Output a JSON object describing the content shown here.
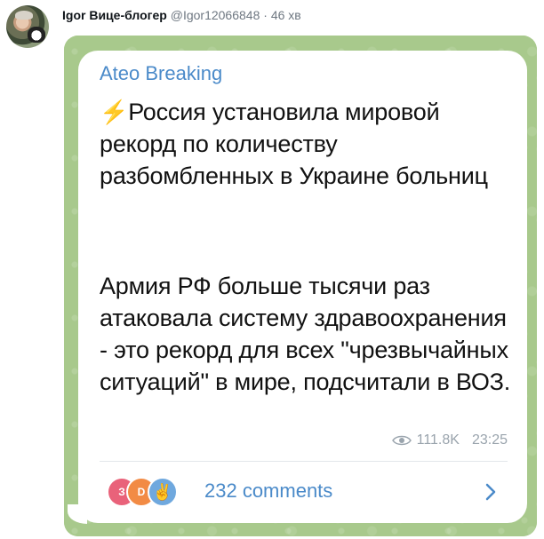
{
  "tweet": {
    "author_name": "Igor Вице-блогер",
    "author_handle": "@Igor12066848",
    "separator": "·",
    "time": "46 хв"
  },
  "telegram_post": {
    "channel_name": "Ateo Breaking",
    "headline_icon": "lightning-icon",
    "headline": "Россия установила мировой рекорд по количеству разбомбленных в Украине больниц",
    "body": "Армия РФ больше тысячи раз атаковала систему здравоохранения - это рекорд для всех \"чрезвычайных ситуаций\" в мире, подсчитали в ВОЗ.",
    "views": "111.8K",
    "post_time": "23:25",
    "comment_avatars": [
      {
        "letter": "З",
        "color": "#e9627a"
      },
      {
        "letter": "D",
        "color": "#f28b45"
      },
      {
        "letter": "✌",
        "color": "#6fa8de"
      }
    ],
    "comments_label": "232 comments"
  },
  "colors": {
    "accent_blue": "#4a8ac9",
    "background_green": "#a8c98c",
    "lightning": "#f2b527"
  }
}
